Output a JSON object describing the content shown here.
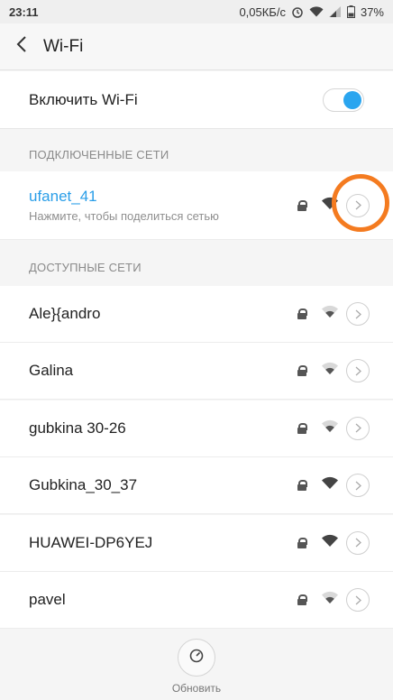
{
  "status_bar": {
    "time": "23:11",
    "network_speed": "0,05КБ/с",
    "battery": "37%",
    "icons": [
      "alarm-icon",
      "wifi-icon",
      "signal-icon",
      "battery-icon"
    ]
  },
  "header": {
    "title": "Wi-Fi",
    "back_icon": "chevron-left-icon"
  },
  "wifi_toggle": {
    "label": "Включить Wi-Fi",
    "enabled": true,
    "accent": "#2aa5ef"
  },
  "connected_section": {
    "title": "ПОДКЛЮЧЕННЫЕ СЕТИ",
    "network": {
      "name": "ufanet_41",
      "subtitle": "Нажмите, чтобы поделиться сетью",
      "secured": true,
      "name_color": "#2a9ee8"
    },
    "highlight_color": "#f47b20"
  },
  "available_section": {
    "title": "ДОСТУПНЫЕ СЕТИ",
    "networks": [
      {
        "name": "Ale}{andro",
        "secured": true,
        "signal": "weak"
      },
      {
        "name": "Galina",
        "secured": true,
        "signal": "weak"
      },
      {
        "name": "gubkina 30-26",
        "secured": true,
        "signal": "weak"
      },
      {
        "name": "Gubkina_30_37",
        "secured": true,
        "signal": "strong"
      },
      {
        "name": "HUAWEI-DP6YEJ",
        "secured": true,
        "signal": "strong"
      },
      {
        "name": "pavel",
        "secured": true,
        "signal": "weak"
      }
    ]
  },
  "refresh": {
    "label": "Обновить",
    "icon": "refresh-icon"
  }
}
